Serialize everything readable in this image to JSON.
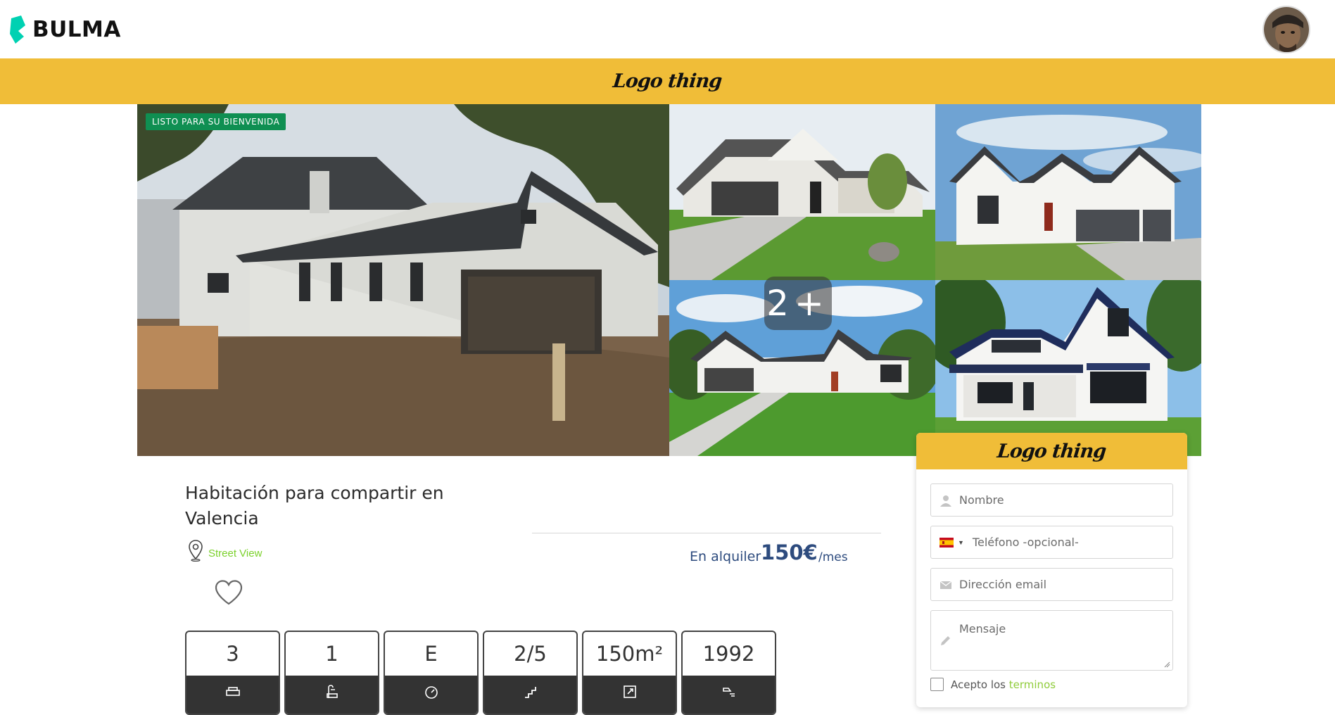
{
  "navbar": {
    "brand": "BULMA",
    "brand_color": "#00d1b2"
  },
  "banner": {
    "logo_text": "Logo thing",
    "color": "#f0bd38"
  },
  "gallery": {
    "badge": "LISTO PARA SU BIENVENIDA",
    "more_count": "2+",
    "photo_count_visible": 5
  },
  "listing": {
    "title": "Habitación para compartir en Valencia",
    "street_view": "Street View",
    "price_label": "En alquiler",
    "price_value": "150€",
    "price_unit": "/mes",
    "features": [
      {
        "value": "3",
        "icon": "bed-icon"
      },
      {
        "value": "1",
        "icon": "shower-icon"
      },
      {
        "value": "E",
        "icon": "energy-icon"
      },
      {
        "value": "2/5",
        "icon": "stairs-icon"
      },
      {
        "value": "150m²",
        "icon": "area-icon"
      },
      {
        "value": "1992",
        "icon": "year-icon"
      }
    ]
  },
  "contact_form": {
    "header_logo": "Logo thing",
    "name_placeholder": "Nombre",
    "phone_placeholder": "Teléfono -opcional-",
    "email_placeholder": "Dirección email",
    "message_placeholder": "Mensaje",
    "terms_prefix": "Acepto los",
    "terms_link": "terminos"
  }
}
